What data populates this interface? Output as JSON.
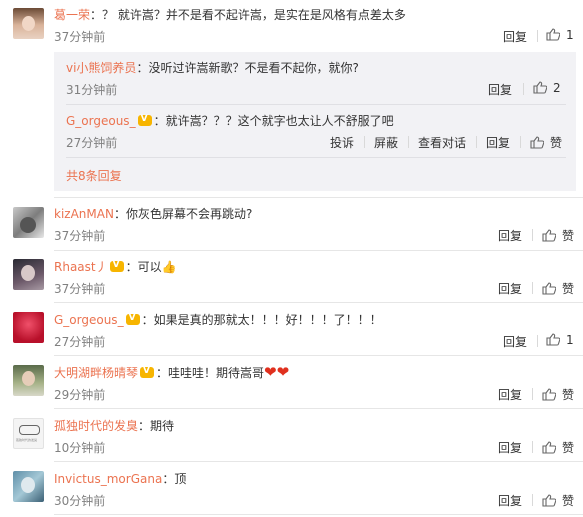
{
  "comments": [
    {
      "user": "葛一荣",
      "text": "：？ 就许嵩？并不是看不起许嵩，是实在是风格有点差太多",
      "time": "37分钟前",
      "reply": "回复",
      "likes": "1"
    },
    {
      "user": "kizAnMAN",
      "text": "：你灰色屏幕不会再跳动?",
      "time": "37分钟前",
      "reply": "回复",
      "likes": "赞"
    },
    {
      "user": "Rhaast丿",
      "text": "：可以👍",
      "time": "37分钟前",
      "reply": "回复",
      "likes": "赞"
    },
    {
      "user": "G_orgeous_",
      "text": "：如果是真的那就太！！！好！！！了！！！",
      "time": "27分钟前",
      "reply": "回复",
      "likes": "1"
    },
    {
      "user": "大明湖畔杨晴琴",
      "text": "：哇哇哇！期待嵩哥",
      "time": "29分钟前",
      "reply": "回复",
      "likes": "赞"
    },
    {
      "user": "孤独时代的发臭",
      "text": "：期待",
      "time": "10分钟前",
      "reply": "回复",
      "likes": "赞"
    },
    {
      "user": "Invictus_morGana",
      "text": "：顶",
      "time": "30分钟前",
      "reply": "回复",
      "likes": "赞"
    }
  ],
  "replies": [
    {
      "user": "vi小熊饲养员",
      "text": "：没听过许嵩新歌？不是看不起你，就你?",
      "time": "31分钟前",
      "reply": "回复",
      "likes": "2"
    },
    {
      "user": "G_orgeous_",
      "text": "：就许嵩？？？这个就字也太让人不舒服了吧",
      "time": "27分钟前",
      "report": "投诉",
      "block": "屏蔽",
      "view_conv": "查看对话",
      "reply": "回复",
      "likes": "赞"
    }
  ],
  "more_replies": "共8条回复",
  "avatar_caption": "孤独时代的发臭",
  "colors": {
    "username": "#eb7350",
    "link": "#eb7350",
    "muted": "#808080",
    "reply_bg": "#f2f2f5"
  }
}
